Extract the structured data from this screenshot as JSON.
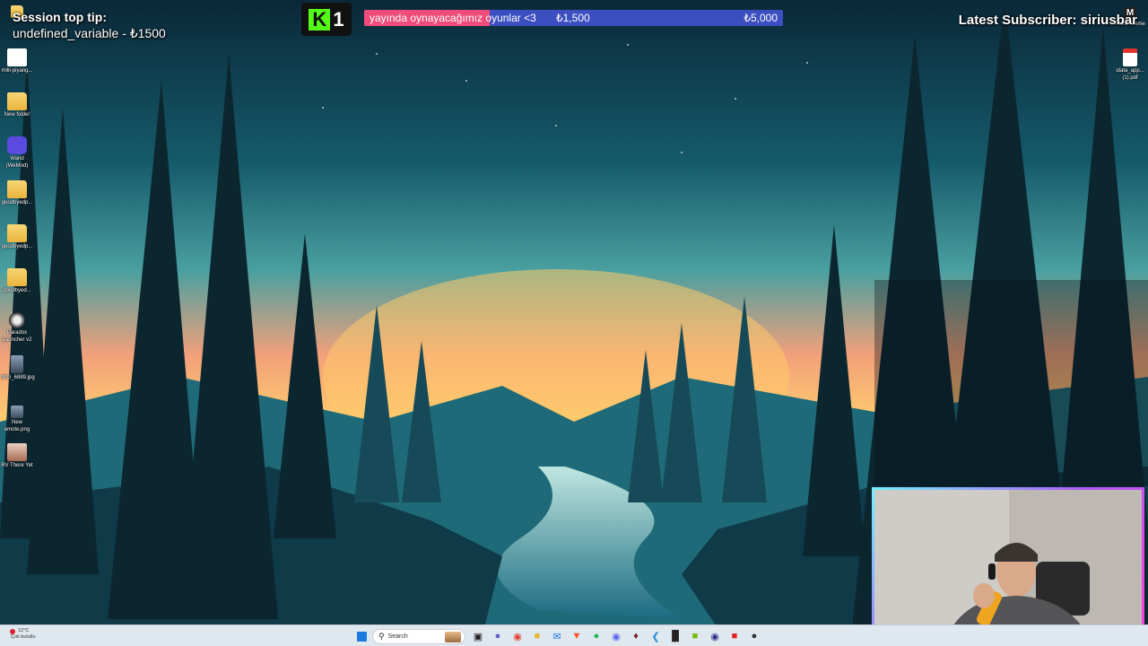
{
  "overlay": {
    "tip_title": "Session top tip:",
    "tip_value": "undefined_variable - ₺1500",
    "kick_letter": "K",
    "kick_count": "1",
    "goal": {
      "label": "yayında oynayacağımız oyunlar <3",
      "current": "₺1,500",
      "target": "₺5,000",
      "progress": 0.3
    },
    "latest_subscriber": "Latest Subscriber: siriusbar"
  },
  "desktop": {
    "left_icons": [
      {
        "label": "milli-piyang...",
        "icon": "doc-icon"
      },
      {
        "label": "New folder",
        "icon": "folder-icon"
      },
      {
        "label": "Wand (WeMod)",
        "icon": "wand-icon"
      },
      {
        "label": "goodbyedp...",
        "icon": "folder-icon"
      },
      {
        "label": "goodbyedp...",
        "icon": "folder-icon"
      },
      {
        "label": "goodbyed...",
        "icon": "folder-icon"
      },
      {
        "label": "Paradox Launcher v2",
        "icon": "paradox-icon"
      },
      {
        "label": "IMG_6889.jpg",
        "icon": "photo-icon"
      },
      {
        "label": "New emote.png",
        "icon": "photo-icon"
      },
      {
        "label": "RV There Yet",
        "icon": "game-icon"
      }
    ],
    "right_icons": [
      {
        "label": "Fever Meme",
        "icon": "fever-meme-icon"
      },
      {
        "label": "idata_app... (1).pdf",
        "icon": "pdf-icon"
      }
    ]
  },
  "taskbar": {
    "weather_temp": "12°C",
    "weather_desc": "Çok bulutlu",
    "search_placeholder": "Search",
    "apps": [
      "windows-start-icon",
      "task-view-icon",
      "teams-icon",
      "chrome-icon",
      "file-explorer-icon",
      "mail-icon",
      "brave-icon",
      "spotify-icon",
      "discord-icon",
      "game-icon",
      "vscode-icon",
      "terminal-icon",
      "nvidia-icon",
      "obs-icon",
      "app-icon",
      "steam-icon"
    ]
  },
  "colors": {
    "goal_fill": "#ef4c7b",
    "goal_bg": "#3b4fc0",
    "kick_green": "#53fc18"
  }
}
